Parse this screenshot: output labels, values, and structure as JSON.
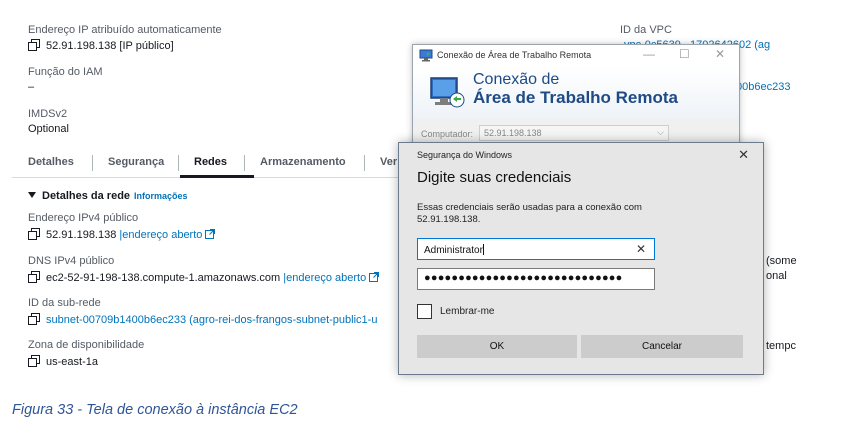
{
  "aws": {
    "auto_ip_label": "Endereço IP atribuído automaticamente",
    "auto_ip_value": "52.91.198.138 [IP público]",
    "iam_label": "Função do IAM",
    "iam_value": "–",
    "imds_label": "IMDSv2",
    "imds_value": "Optional",
    "vpc_label": "ID da VPC",
    "vpc_value_partial": "vpc-0c5639...1702642602 (ag",
    "right_value_partial": "00b6ec233",
    "right_fragment_1": "(some",
    "right_fragment_2": "onal",
    "right_fragment_3": "tempc",
    "tabs": [
      "Detalhes",
      "Segurança",
      "Redes",
      "Armazenamento",
      "Ver"
    ],
    "active_tab": "Redes",
    "network_section_title": "Detalhes da rede",
    "network_section_info": "Informações",
    "public_ipv4_label": "Endereço IPv4 público",
    "public_ipv4_value": "52.91.198.138",
    "public_ipv4_link": "|endereço aberto",
    "public_dns_label": "DNS IPv4 público",
    "public_dns_value": "ec2-52-91-198-138.compute-1.amazonaws.com",
    "public_dns_link": "|endereço aberto",
    "subnet_label": "ID da sub-rede",
    "subnet_value": "subnet-00709b1400b6ec233 (agro-rei-dos-frangos-subnet-public1-u",
    "az_label": "Zona de disponibilidade",
    "az_value": "us-east-1a"
  },
  "rdp": {
    "window_title": "Conexão de Área de Trabalho Remota",
    "heading_line1": "Conexão de",
    "heading_line2": "Área de Trabalho Remota",
    "computer_label": "Computador:",
    "computer_value": "52.91.198.138",
    "minimize_glyph": "—",
    "maximize_glyph": "☐",
    "close_glyph": "✕"
  },
  "security_dialog": {
    "title": "Segurança do Windows",
    "close_glyph": "✕",
    "heading": "Digite suas credenciais",
    "description_line1": "Essas credenciais serão usadas para a conexão com",
    "description_line2": "52.91.198.138.",
    "username_value": "Administrator",
    "username_clear_glyph": "✕",
    "password_masked": "●●●●●●●●●●●●●●●●●●●●●●●●●●●●●",
    "remember_label": "Lembrar-me",
    "remember_checked": false,
    "ok_label": "OK",
    "cancel_label": "Cancelar"
  },
  "caption": "Figura 33 - Tela de conexão à instância EC2",
  "colors": {
    "aws_link": "#0073bb",
    "caption": "#2f5597",
    "rdp_heading": "#1e4a86",
    "dialog_bg": "#e6e6e6",
    "focus_border": "#0078d7"
  }
}
